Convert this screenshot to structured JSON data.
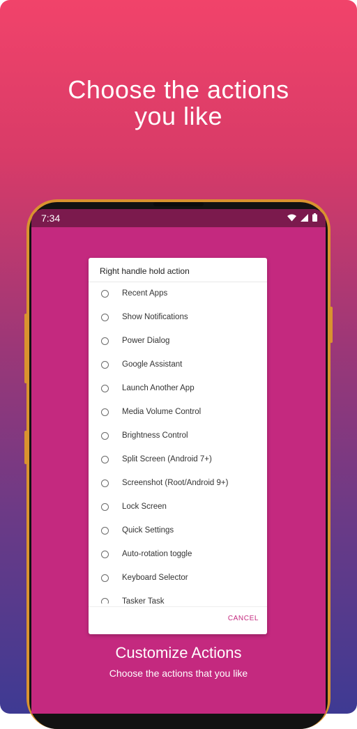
{
  "headline": {
    "line1": "Choose the actions",
    "line2": "you like"
  },
  "status_bar": {
    "time": "7:34",
    "icons": [
      "wifi-icon",
      "signal-icon",
      "battery-icon"
    ]
  },
  "dialog": {
    "title": "Right handle hold action",
    "options": [
      "Recent Apps",
      "Show Notifications",
      "Power Dialog",
      "Google Assistant",
      "Launch Another App",
      "Media Volume Control",
      "Brightness Control",
      "Split Screen (Android 7+)",
      "Screenshot (Root/Android 9+)",
      "Lock Screen",
      "Quick Settings",
      "Auto-rotation toggle",
      "Keyboard Selector",
      "Tasker Task"
    ],
    "cancel_label": "CANCEL"
  },
  "caption": {
    "title": "Customize Actions",
    "subtitle": "Choose the actions that you like"
  },
  "colors": {
    "screen_bg": "#c4297f",
    "status_bar_bg": "#7b1a4d",
    "phone_frame": "#d9932f",
    "accent": "#c4297f"
  }
}
